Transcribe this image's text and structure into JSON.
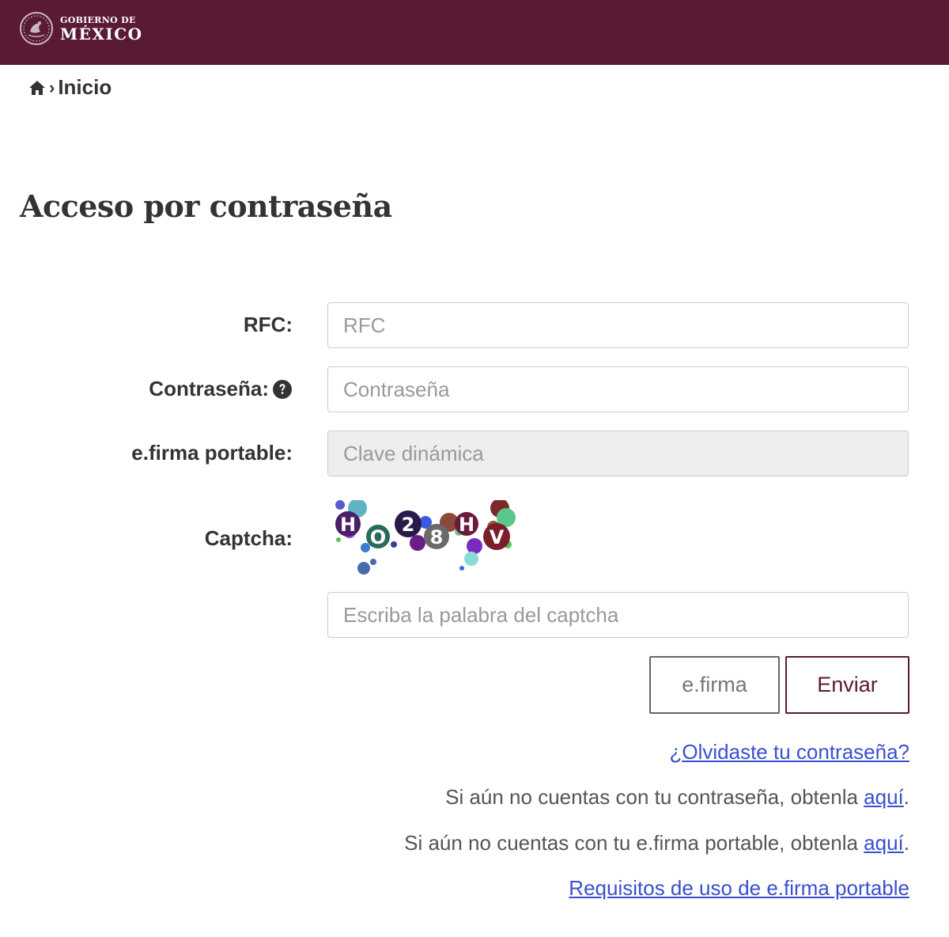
{
  "header": {
    "logo_line1": "GOBIERNO DE",
    "logo_line2": "MÉXICO",
    "background_color": "#5a1a33"
  },
  "breadcrumb": {
    "home_icon": "home-icon",
    "separator": "›",
    "label": "Inicio"
  },
  "page_title": "Acceso por contraseña",
  "form": {
    "rfc": {
      "label": "RFC:",
      "placeholder": "RFC",
      "value": ""
    },
    "password": {
      "label": "Contraseña:",
      "placeholder": "Contraseña",
      "value": "",
      "help_icon": "question-circle-icon"
    },
    "efirma_portable": {
      "label": "e.firma portable:",
      "placeholder": "Clave dinámica",
      "value": "",
      "disabled": true
    },
    "captcha": {
      "label": "Captcha:",
      "image_text": "HO28HV",
      "placeholder": "Escriba la palabra del captcha",
      "value": ""
    }
  },
  "buttons": {
    "efirma_label": "e.firma",
    "enviar_label": "Enviar",
    "accent_color": "#5a1a33"
  },
  "links": {
    "forgot_password": "¿Olvidaste tu contraseña?",
    "no_password_text": "Si aún no cuentas con tu contraseña, obtenla ",
    "no_password_link": "aquí",
    "no_efirma_text": "Si aún no cuentas con tu e.firma portable, obtenla ",
    "no_efirma_link": "aquí",
    "period": ".",
    "requisitos": "Requisitos de uso de e.firma portable",
    "link_color": "#3a4fd0"
  }
}
